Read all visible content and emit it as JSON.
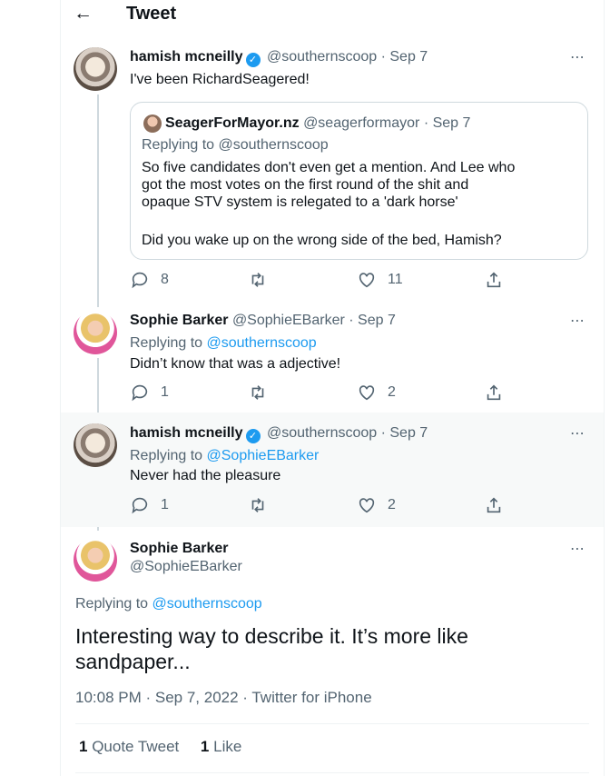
{
  "header": {
    "back_icon": "arrow-left-icon",
    "title": "Tweet"
  },
  "original": {
    "name": "hamish mcneilly",
    "handle": "@southernscoop",
    "date": "· Sep 7",
    "text": "I've been RichardSeagered!",
    "quote": {
      "name": "SeagerForMayor.nz",
      "handle": "@seagerformayor",
      "date": "· Sep 7",
      "replying_label": "Replying to",
      "replying_to": "@southernscoop",
      "lines": [
        "So five candidates don't even get a mention. And Lee who",
        "got the most votes on the first round of the shit and",
        "opaque STV system is relegated to a 'dark horse'",
        "Did you wake up on the wrong side of the bed, Hamish?"
      ]
    },
    "stats": {
      "replies": "8",
      "retweets": "",
      "likes": "11"
    }
  },
  "reply1": {
    "name": "Sophie Barker",
    "handle": "@SophieEBarker",
    "date": "· Sep 7",
    "replying_label": "Replying to",
    "replying_to": "@southernscoop",
    "text": "Didn’t know that was a adjective!",
    "stats": {
      "replies": "1",
      "retweets": "",
      "likes": "2"
    }
  },
  "reply2": {
    "name": "hamish mcneilly",
    "handle": "@southernscoop",
    "date": "· Sep 7",
    "replying_label": "Replying to",
    "replying_to": "@SophieEBarker",
    "text": "Never had the pleasure",
    "stats": {
      "replies": "1",
      "retweets": "",
      "likes": "2"
    }
  },
  "focused": {
    "name": "Sophie Barker",
    "handle": "@SophieEBarker",
    "replying_label": "Replying to",
    "replying_to": "@southernscoop",
    "text": "Interesting way to describe it. It’s more like sandpaper...",
    "timestamp": "10:08 PM · Sep 7, 2022 · Twitter for iPhone",
    "quote_count": "1",
    "quote_label": "Quote Tweet",
    "like_count": "1",
    "like_label": "Like"
  },
  "more_icon": "⋯",
  "colors": {
    "accent": "#1d9bf0",
    "gray": "#536471",
    "verified": "#1d9bf0",
    "highlight_bg": "#f7f9f9"
  }
}
